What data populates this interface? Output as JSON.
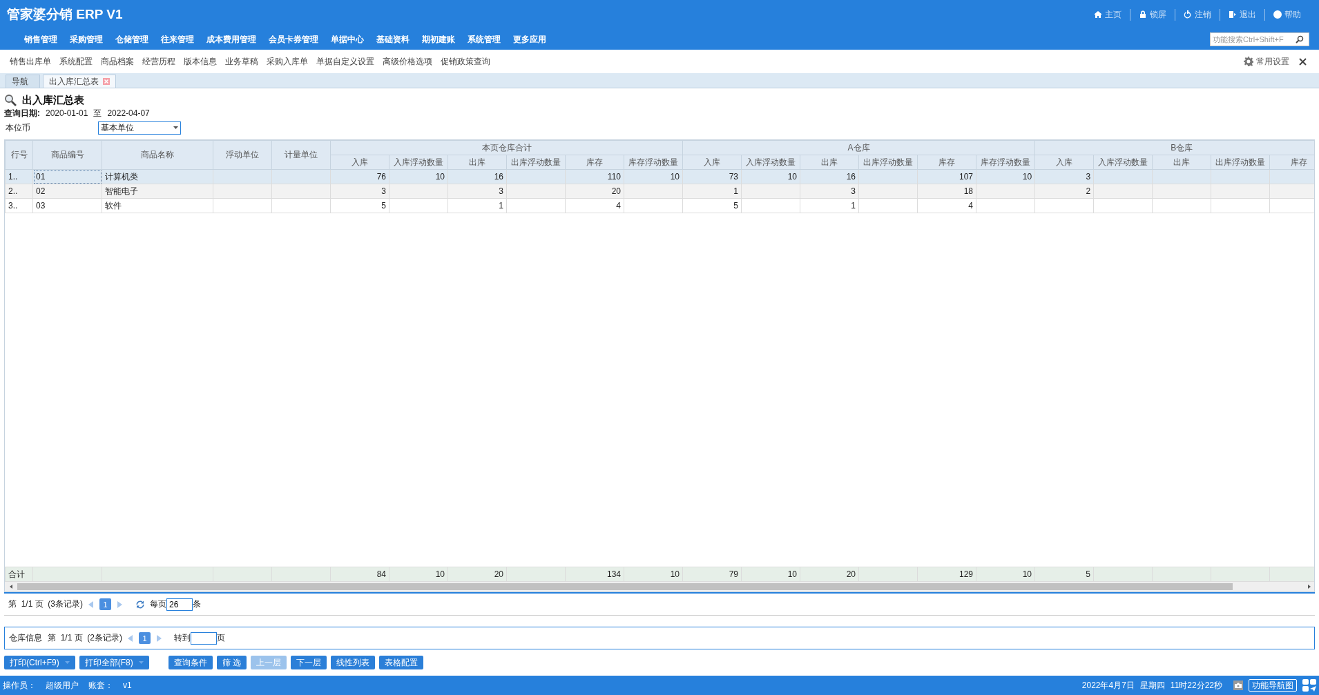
{
  "app": {
    "title": "管家婆分销 ERP V1"
  },
  "top_links": [
    {
      "label": "主页"
    },
    {
      "label": "锁屏"
    },
    {
      "label": "注销"
    },
    {
      "label": "退出"
    },
    {
      "label": "帮助"
    }
  ],
  "search": {
    "placeholder": "功能搜索Ctrl+Shift+F"
  },
  "menu": [
    "销售管理",
    "采购管理",
    "仓储管理",
    "往来管理",
    "成本费用管理",
    "会员卡券管理",
    "单据中心",
    "基础资料",
    "期初建账",
    "系统管理",
    "更多应用"
  ],
  "quick_links": [
    "销售出库单",
    "系统配置",
    "商品档案",
    "经营历程",
    "版本信息",
    "业务草稿",
    "采购入库单",
    "单据自定义设置",
    "高级价格选项",
    "促销政策查询"
  ],
  "settings_label": "常用设置",
  "tabs": [
    {
      "label": "导航",
      "selected": false,
      "closable": false
    },
    {
      "label": "出入库汇总表",
      "selected": true,
      "closable": true
    }
  ],
  "report": {
    "title": "出入库汇总表",
    "date_label": "查询日期:",
    "date_from": "2020-01-01",
    "date_sep": "至",
    "date_to": "2022-04-07",
    "currency_label": "本位币",
    "unit_select": "基本单位"
  },
  "table": {
    "columns": [
      "行号",
      "商品编号",
      "商品名称",
      "浮动单位",
      "计量单位"
    ],
    "groups": [
      {
        "name": "本页仓库合计",
        "columns": [
          "入库",
          "入库浮动数量",
          "出库",
          "出库浮动数量",
          "库存",
          "库存浮动数量"
        ]
      },
      {
        "name": "A仓库",
        "columns": [
          "入库",
          "入库浮动数量",
          "出库",
          "出库浮动数量",
          "库存",
          "库存浮动数量"
        ]
      },
      {
        "name": "B仓库",
        "columns": [
          "入库",
          "入库浮动数量",
          "出库",
          "出库浮动数量",
          "库存"
        ]
      }
    ],
    "rows": [
      {
        "number": "1..",
        "code": "01",
        "name": "计算机类",
        "selected": true,
        "values": [
          {
            "in": "76",
            "in_float": "10",
            "out": "16",
            "stock": "110",
            "stock_float": "10"
          },
          {
            "in": "73",
            "in_float": "10",
            "out": "16",
            "stock": "107",
            "stock_float": "10"
          },
          {
            "in": "3"
          }
        ]
      },
      {
        "number": "2..",
        "code": "02",
        "name": "智能电子",
        "selected": false,
        "values": [
          {
            "in": "3",
            "out": "3",
            "stock": "20"
          },
          {
            "in": "1",
            "out": "3",
            "stock": "18"
          },
          {
            "in": "2"
          }
        ]
      },
      {
        "number": "3..",
        "code": "03",
        "name": "软件",
        "selected": false,
        "values": [
          {
            "in": "5",
            "out": "1",
            "stock": "4"
          },
          {
            "in": "5",
            "out": "1",
            "stock": "4"
          }
        ]
      }
    ],
    "total": {
      "label": "合计",
      "values": [
        {
          "in": "84",
          "in_float": "10",
          "out": "20",
          "stock": "134",
          "stock_float": "10"
        },
        {
          "in": "79",
          "in_float": "10",
          "out": "20",
          "stock": "129",
          "stock_float": "10"
        },
        {
          "in": "5"
        }
      ]
    }
  },
  "pager": {
    "info": "第  1/1 页  (3条记录)",
    "page": "1",
    "per_page_label": "每页",
    "per_page": "26",
    "unit": "条"
  },
  "warehouse_pager": {
    "label": "仓库信息",
    "info": "第  1/1 页  (2条记录)",
    "page": "1",
    "goto_label": "转到",
    "goto_unit": "页"
  },
  "buttons": [
    {
      "label": "打印(Ctrl+F9)",
      "disabled": false,
      "dropdown": true
    },
    {
      "label": "打印全部(F8)",
      "disabled": false,
      "dropdown": true
    },
    {
      "label": "查询条件",
      "disabled": false,
      "dropdown": false
    },
    {
      "label": "筛 选",
      "disabled": false,
      "dropdown": false
    },
    {
      "label": "上一层",
      "disabled": true,
      "dropdown": false
    },
    {
      "label": "下一层",
      "disabled": false,
      "dropdown": false
    },
    {
      "label": "线性列表",
      "disabled": false,
      "dropdown": false
    },
    {
      "label": "表格配置",
      "disabled": false,
      "dropdown": false
    }
  ],
  "status": {
    "operator_label": "操作员：",
    "operator": "超级用户",
    "account_label": "账套：",
    "account": "v1",
    "date": "2022年4月7日",
    "weekday": "星期四",
    "time": "11时22分22秒",
    "nav_button": "功能导航图"
  }
}
